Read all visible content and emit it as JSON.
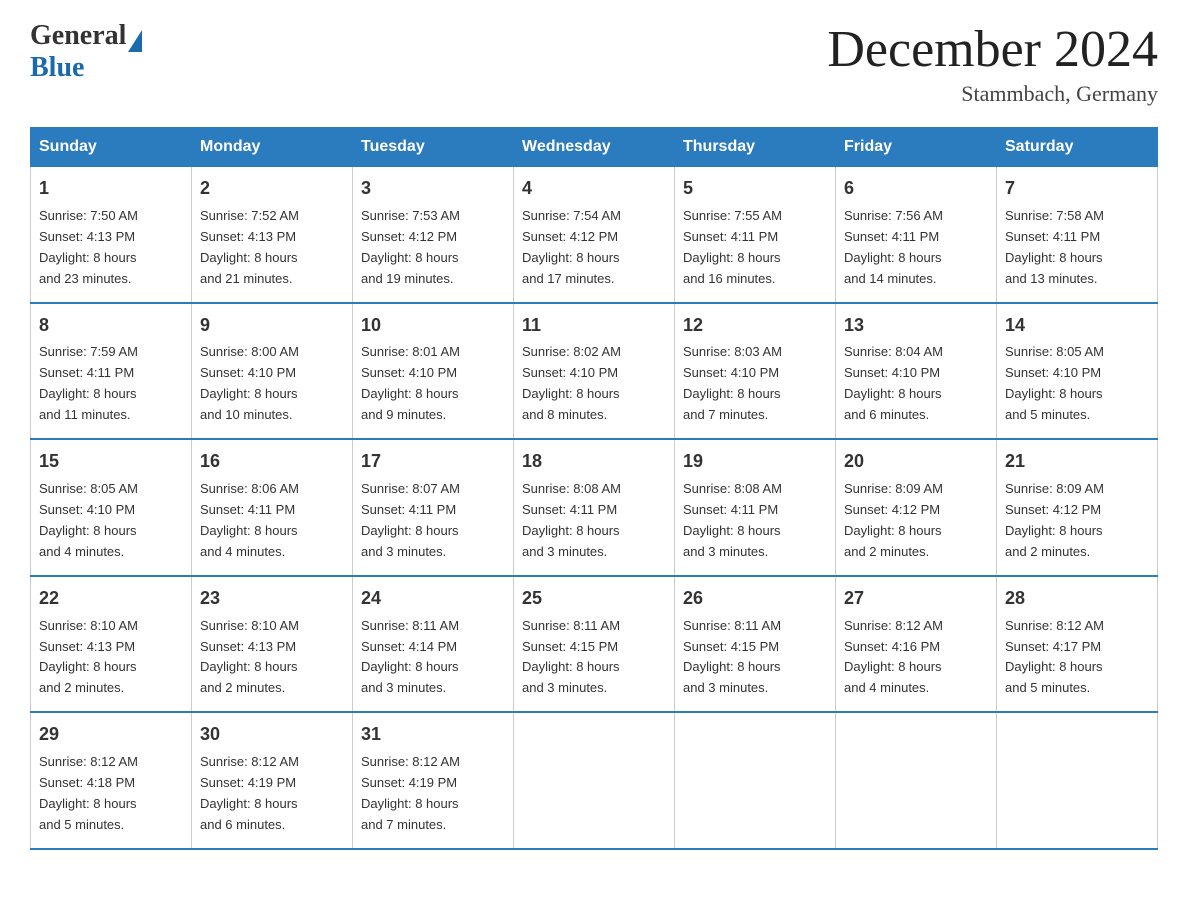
{
  "header": {
    "logo_general": "General",
    "logo_blue": "Blue",
    "month_title": "December 2024",
    "location": "Stammbach, Germany"
  },
  "weekdays": [
    "Sunday",
    "Monday",
    "Tuesday",
    "Wednesday",
    "Thursday",
    "Friday",
    "Saturday"
  ],
  "weeks": [
    [
      {
        "day": "1",
        "sunrise": "7:50 AM",
        "sunset": "4:13 PM",
        "daylight": "8 hours and 23 minutes."
      },
      {
        "day": "2",
        "sunrise": "7:52 AM",
        "sunset": "4:13 PM",
        "daylight": "8 hours and 21 minutes."
      },
      {
        "day": "3",
        "sunrise": "7:53 AM",
        "sunset": "4:12 PM",
        "daylight": "8 hours and 19 minutes."
      },
      {
        "day": "4",
        "sunrise": "7:54 AM",
        "sunset": "4:12 PM",
        "daylight": "8 hours and 17 minutes."
      },
      {
        "day": "5",
        "sunrise": "7:55 AM",
        "sunset": "4:11 PM",
        "daylight": "8 hours and 16 minutes."
      },
      {
        "day": "6",
        "sunrise": "7:56 AM",
        "sunset": "4:11 PM",
        "daylight": "8 hours and 14 minutes."
      },
      {
        "day": "7",
        "sunrise": "7:58 AM",
        "sunset": "4:11 PM",
        "daylight": "8 hours and 13 minutes."
      }
    ],
    [
      {
        "day": "8",
        "sunrise": "7:59 AM",
        "sunset": "4:11 PM",
        "daylight": "8 hours and 11 minutes."
      },
      {
        "day": "9",
        "sunrise": "8:00 AM",
        "sunset": "4:10 PM",
        "daylight": "8 hours and 10 minutes."
      },
      {
        "day": "10",
        "sunrise": "8:01 AM",
        "sunset": "4:10 PM",
        "daylight": "8 hours and 9 minutes."
      },
      {
        "day": "11",
        "sunrise": "8:02 AM",
        "sunset": "4:10 PM",
        "daylight": "8 hours and 8 minutes."
      },
      {
        "day": "12",
        "sunrise": "8:03 AM",
        "sunset": "4:10 PM",
        "daylight": "8 hours and 7 minutes."
      },
      {
        "day": "13",
        "sunrise": "8:04 AM",
        "sunset": "4:10 PM",
        "daylight": "8 hours and 6 minutes."
      },
      {
        "day": "14",
        "sunrise": "8:05 AM",
        "sunset": "4:10 PM",
        "daylight": "8 hours and 5 minutes."
      }
    ],
    [
      {
        "day": "15",
        "sunrise": "8:05 AM",
        "sunset": "4:10 PM",
        "daylight": "8 hours and 4 minutes."
      },
      {
        "day": "16",
        "sunrise": "8:06 AM",
        "sunset": "4:11 PM",
        "daylight": "8 hours and 4 minutes."
      },
      {
        "day": "17",
        "sunrise": "8:07 AM",
        "sunset": "4:11 PM",
        "daylight": "8 hours and 3 minutes."
      },
      {
        "day": "18",
        "sunrise": "8:08 AM",
        "sunset": "4:11 PM",
        "daylight": "8 hours and 3 minutes."
      },
      {
        "day": "19",
        "sunrise": "8:08 AM",
        "sunset": "4:11 PM",
        "daylight": "8 hours and 3 minutes."
      },
      {
        "day": "20",
        "sunrise": "8:09 AM",
        "sunset": "4:12 PM",
        "daylight": "8 hours and 2 minutes."
      },
      {
        "day": "21",
        "sunrise": "8:09 AM",
        "sunset": "4:12 PM",
        "daylight": "8 hours and 2 minutes."
      }
    ],
    [
      {
        "day": "22",
        "sunrise": "8:10 AM",
        "sunset": "4:13 PM",
        "daylight": "8 hours and 2 minutes."
      },
      {
        "day": "23",
        "sunrise": "8:10 AM",
        "sunset": "4:13 PM",
        "daylight": "8 hours and 2 minutes."
      },
      {
        "day": "24",
        "sunrise": "8:11 AM",
        "sunset": "4:14 PM",
        "daylight": "8 hours and 3 minutes."
      },
      {
        "day": "25",
        "sunrise": "8:11 AM",
        "sunset": "4:15 PM",
        "daylight": "8 hours and 3 minutes."
      },
      {
        "day": "26",
        "sunrise": "8:11 AM",
        "sunset": "4:15 PM",
        "daylight": "8 hours and 3 minutes."
      },
      {
        "day": "27",
        "sunrise": "8:12 AM",
        "sunset": "4:16 PM",
        "daylight": "8 hours and 4 minutes."
      },
      {
        "day": "28",
        "sunrise": "8:12 AM",
        "sunset": "4:17 PM",
        "daylight": "8 hours and 5 minutes."
      }
    ],
    [
      {
        "day": "29",
        "sunrise": "8:12 AM",
        "sunset": "4:18 PM",
        "daylight": "8 hours and 5 minutes."
      },
      {
        "day": "30",
        "sunrise": "8:12 AM",
        "sunset": "4:19 PM",
        "daylight": "8 hours and 6 minutes."
      },
      {
        "day": "31",
        "sunrise": "8:12 AM",
        "sunset": "4:19 PM",
        "daylight": "8 hours and 7 minutes."
      },
      null,
      null,
      null,
      null
    ]
  ],
  "labels": {
    "sunrise": "Sunrise:",
    "sunset": "Sunset:",
    "daylight": "Daylight:"
  }
}
